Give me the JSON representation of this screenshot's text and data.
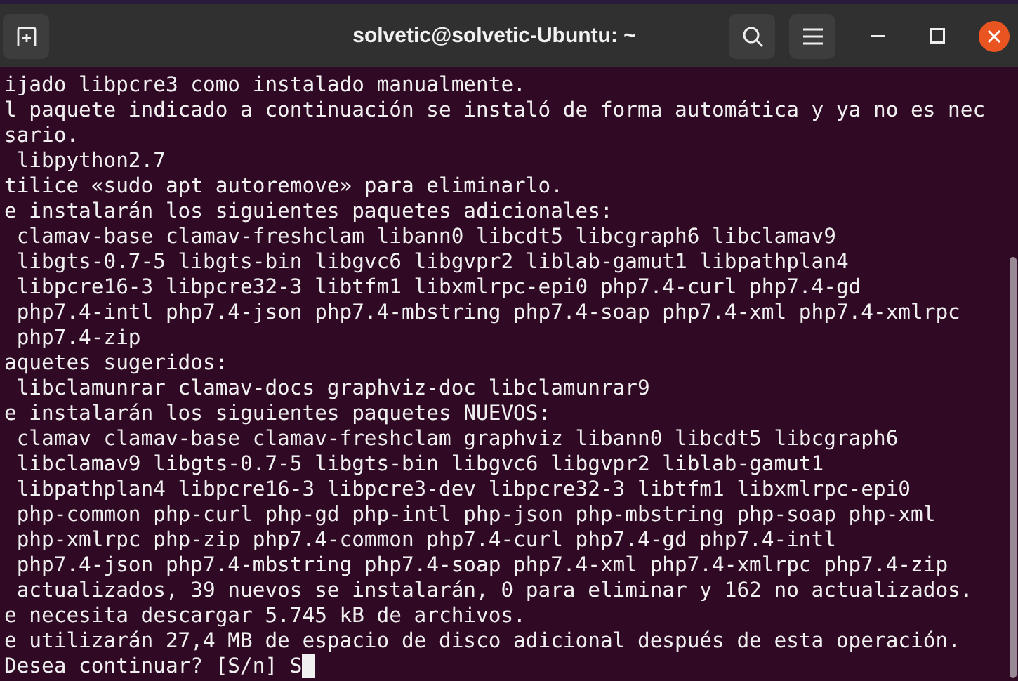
{
  "window": {
    "title": "solvetic@solvetic-Ubuntu: ~"
  },
  "terminal": {
    "lines": [
      "ijado libpcre3 como instalado manualmente.",
      "l paquete indicado a continuación se instaló de forma automática y ya no es nec",
      "sario.",
      " libpython2.7",
      "tilice «sudo apt autoremove» para eliminarlo.",
      "e instalarán los siguientes paquetes adicionales:",
      " clamav-base clamav-freshclam libann0 libcdt5 libcgraph6 libclamav9",
      " libgts-0.7-5 libgts-bin libgvc6 libgvpr2 liblab-gamut1 libpathplan4",
      " libpcre16-3 libpcre32-3 libtfm1 libxmlrpc-epi0 php7.4-curl php7.4-gd",
      " php7.4-intl php7.4-json php7.4-mbstring php7.4-soap php7.4-xml php7.4-xmlrpc",
      " php7.4-zip",
      "aquetes sugeridos:",
      " libclamunrar clamav-docs graphviz-doc libclamunrar9",
      "e instalarán los siguientes paquetes NUEVOS:",
      " clamav clamav-base clamav-freshclam graphviz libann0 libcdt5 libcgraph6",
      " libclamav9 libgts-0.7-5 libgts-bin libgvc6 libgvpr2 liblab-gamut1",
      " libpathplan4 libpcre16-3 libpcre3-dev libpcre32-3 libtfm1 libxmlrpc-epi0",
      " php-common php-curl php-gd php-intl php-json php-mbstring php-soap php-xml",
      " php-xmlrpc php-zip php7.4-common php7.4-curl php7.4-gd php7.4-intl",
      " php7.4-json php7.4-mbstring php7.4-soap php7.4-xml php7.4-xmlrpc php7.4-zip",
      " actualizados, 39 nuevos se instalarán, 0 para eliminar y 162 no actualizados.",
      "e necesita descargar 5.745 kB de archivos.",
      "e utilizarán 27,4 MB de espacio de disco adicional después de esta operación."
    ],
    "prompt": {
      "text": "Desea continuar? [S/n] S",
      "cursor": true
    }
  }
}
